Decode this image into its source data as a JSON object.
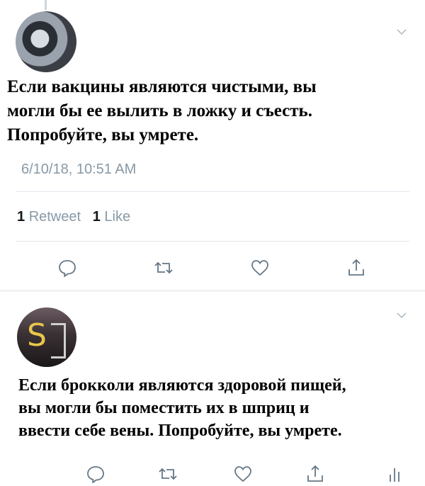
{
  "tweets": [
    {
      "text": "Если вакцины являются чистыми, вы\nмогли бы ее вылить в ложку и съесть.\nПопробуйте, вы умрете.",
      "timestamp": "6/10/18, 10:51 AM",
      "retweet_count": "1",
      "retweet_label": "Retweet",
      "like_count": "1",
      "like_label": "Like"
    },
    {
      "text": "Если брокколи являются здоровой пищей,\nвы могли бы поместить их в шприц и\nввести себе вены. Попробуйте, вы умрете."
    }
  ],
  "icons": [
    "chevron-down-icon",
    "reply-icon",
    "retweet-icon",
    "like-icon",
    "share-icon",
    "analytics-icon"
  ],
  "colors": {
    "icon": "#657786",
    "muted": "#8899a6",
    "divider": "#e1e8ed"
  }
}
